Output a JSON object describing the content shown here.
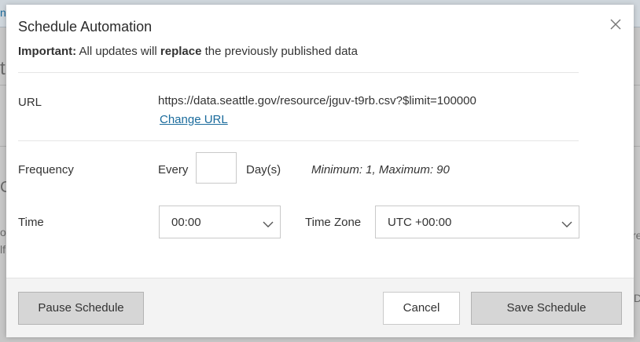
{
  "background": {
    "fragments": [
      "n",
      "t",
      "C",
      "o",
      "lf",
      "re",
      "D"
    ]
  },
  "modal": {
    "title": "Schedule Automation",
    "notice": {
      "important_label": "Important:",
      "text_before": " All updates will ",
      "emphasis": "replace",
      "text_after": " the previously published data"
    },
    "url": {
      "label": "URL",
      "value": "https://data.seattle.gov/resource/jguv-t9rb.csv?$limit=100000",
      "change_link": "Change URL"
    },
    "frequency": {
      "label": "Frequency",
      "prefix": "Every",
      "value": "",
      "unit": "Day(s)",
      "hint": "Minimum: 1, Maximum: 90"
    },
    "time": {
      "label": "Time",
      "value": "00:00"
    },
    "timezone": {
      "label": "Time Zone",
      "value": "UTC +00:00"
    },
    "buttons": {
      "pause": "Pause Schedule",
      "cancel": "Cancel",
      "save": "Save Schedule"
    },
    "icons": {
      "close": "close-icon",
      "dropdown": "chevron-down-icon"
    }
  }
}
